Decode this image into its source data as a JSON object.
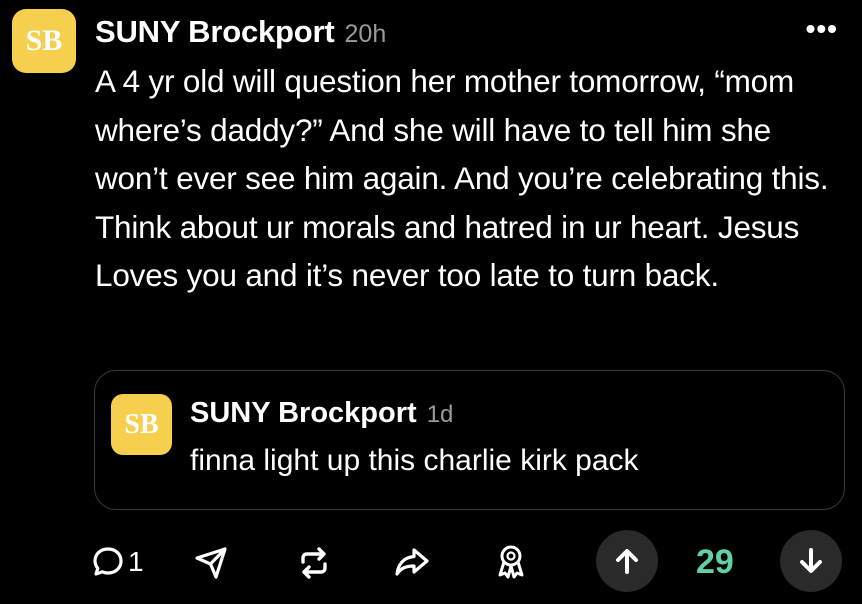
{
  "post": {
    "author_initials": "SB",
    "author": "SUNY Brockport",
    "time": "20h",
    "more_label": "•••",
    "text": "A 4 yr old will question her mother tomorrow, “mom where’s daddy?” And she will have to tell him she won’t ever see him again. And you’re celebrating this. Think about ur morals and hatred in ur heart. Jesus Loves you and it’s never too late to turn back."
  },
  "quoted": {
    "author_initials": "SB",
    "author": "SUNY Brockport",
    "time": "1d",
    "text": "finna light up this charlie kirk pack"
  },
  "actions": {
    "comment_count": "1",
    "vote_count": "29",
    "icons": [
      "comment-icon",
      "send-icon",
      "repost-icon",
      "share-icon",
      "award-icon",
      "upvote-icon",
      "downvote-icon"
    ]
  },
  "colors": {
    "avatar_bg": "#f5cf4d",
    "vote_count": "#5fd1a6",
    "background": "#000000"
  }
}
